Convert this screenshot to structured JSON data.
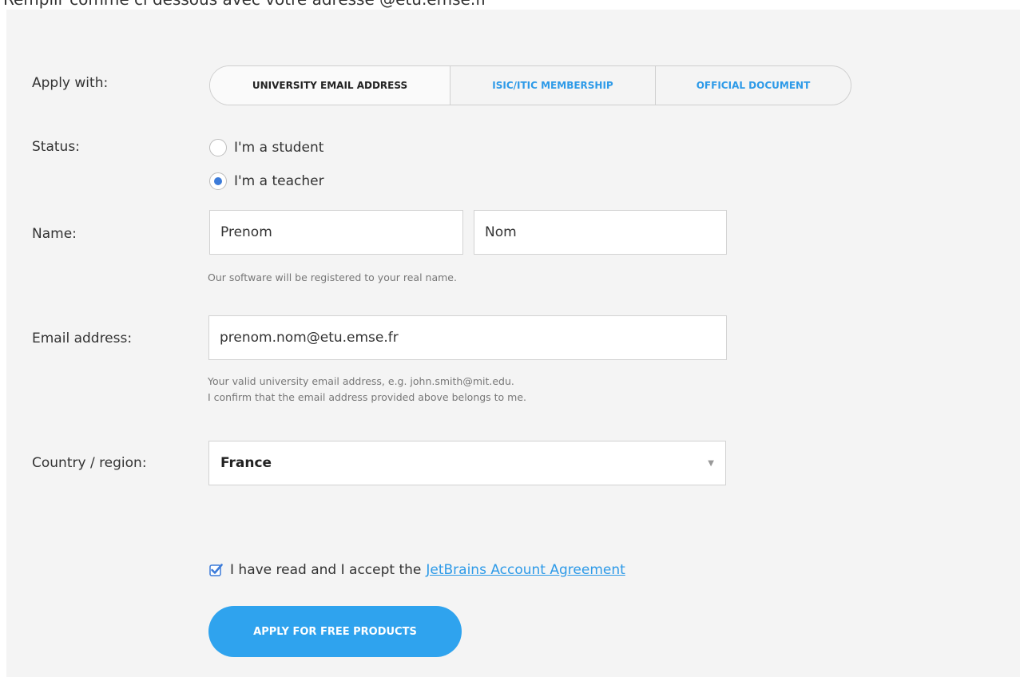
{
  "page": {
    "instruction": "Remplir comme ci dessous avec votre adresse @etu.emse.fr"
  },
  "form": {
    "apply_with": {
      "label": "Apply with:",
      "options": [
        "UNIVERSITY EMAIL ADDRESS",
        "ISIC/ITIC MEMBERSHIP",
        "OFFICIAL DOCUMENT"
      ],
      "selected": "UNIVERSITY EMAIL ADDRESS"
    },
    "status": {
      "label": "Status:",
      "options": [
        "I'm a student",
        "I'm a teacher"
      ],
      "selected": "I'm a teacher"
    },
    "name": {
      "label": "Name:",
      "first_value": "Prenom",
      "last_value": "Nom",
      "hint": "Our software will be registered to your real name."
    },
    "email": {
      "label": "Email address:",
      "value": "prenom.nom@etu.emse.fr",
      "hint_line1": "Your valid university email address, e.g. john.smith@mit.edu.",
      "hint_line2": "I confirm that the email address provided above belongs to me."
    },
    "country": {
      "label": "Country / region:",
      "value": "France"
    },
    "agreement": {
      "text": "I have read and I accept the",
      "link": "JetBrains Account Agreement",
      "checked": true
    },
    "submit_label": "APPLY FOR FREE PRODUCTS"
  },
  "colors": {
    "accent": "#2fa3ee",
    "link": "#2d9ae8",
    "radio_checked": "#3c7bd9",
    "panel_bg": "#f4f4f4"
  },
  "icons": {
    "caret": "chevron-down-icon",
    "checkbox": "checkbox-checked-icon"
  }
}
